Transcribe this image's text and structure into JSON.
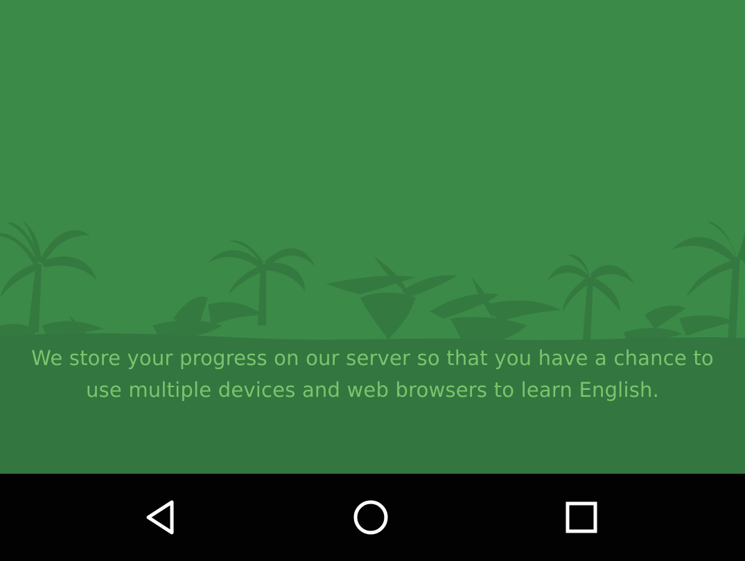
{
  "screen": {
    "background_color": "#3c8a48",
    "silhouette_color": "#347a40",
    "ground_color": "#337640"
  },
  "message": {
    "text": "We store your progress on our server so that you have a chance to use multiple devices and web browsers to learn English.",
    "color": "#7cc46c"
  },
  "navbar": {
    "background_color": "#020202",
    "buttons": [
      {
        "icon": "back-triangle-icon"
      },
      {
        "icon": "home-circle-icon"
      },
      {
        "icon": "recents-square-icon"
      }
    ]
  }
}
